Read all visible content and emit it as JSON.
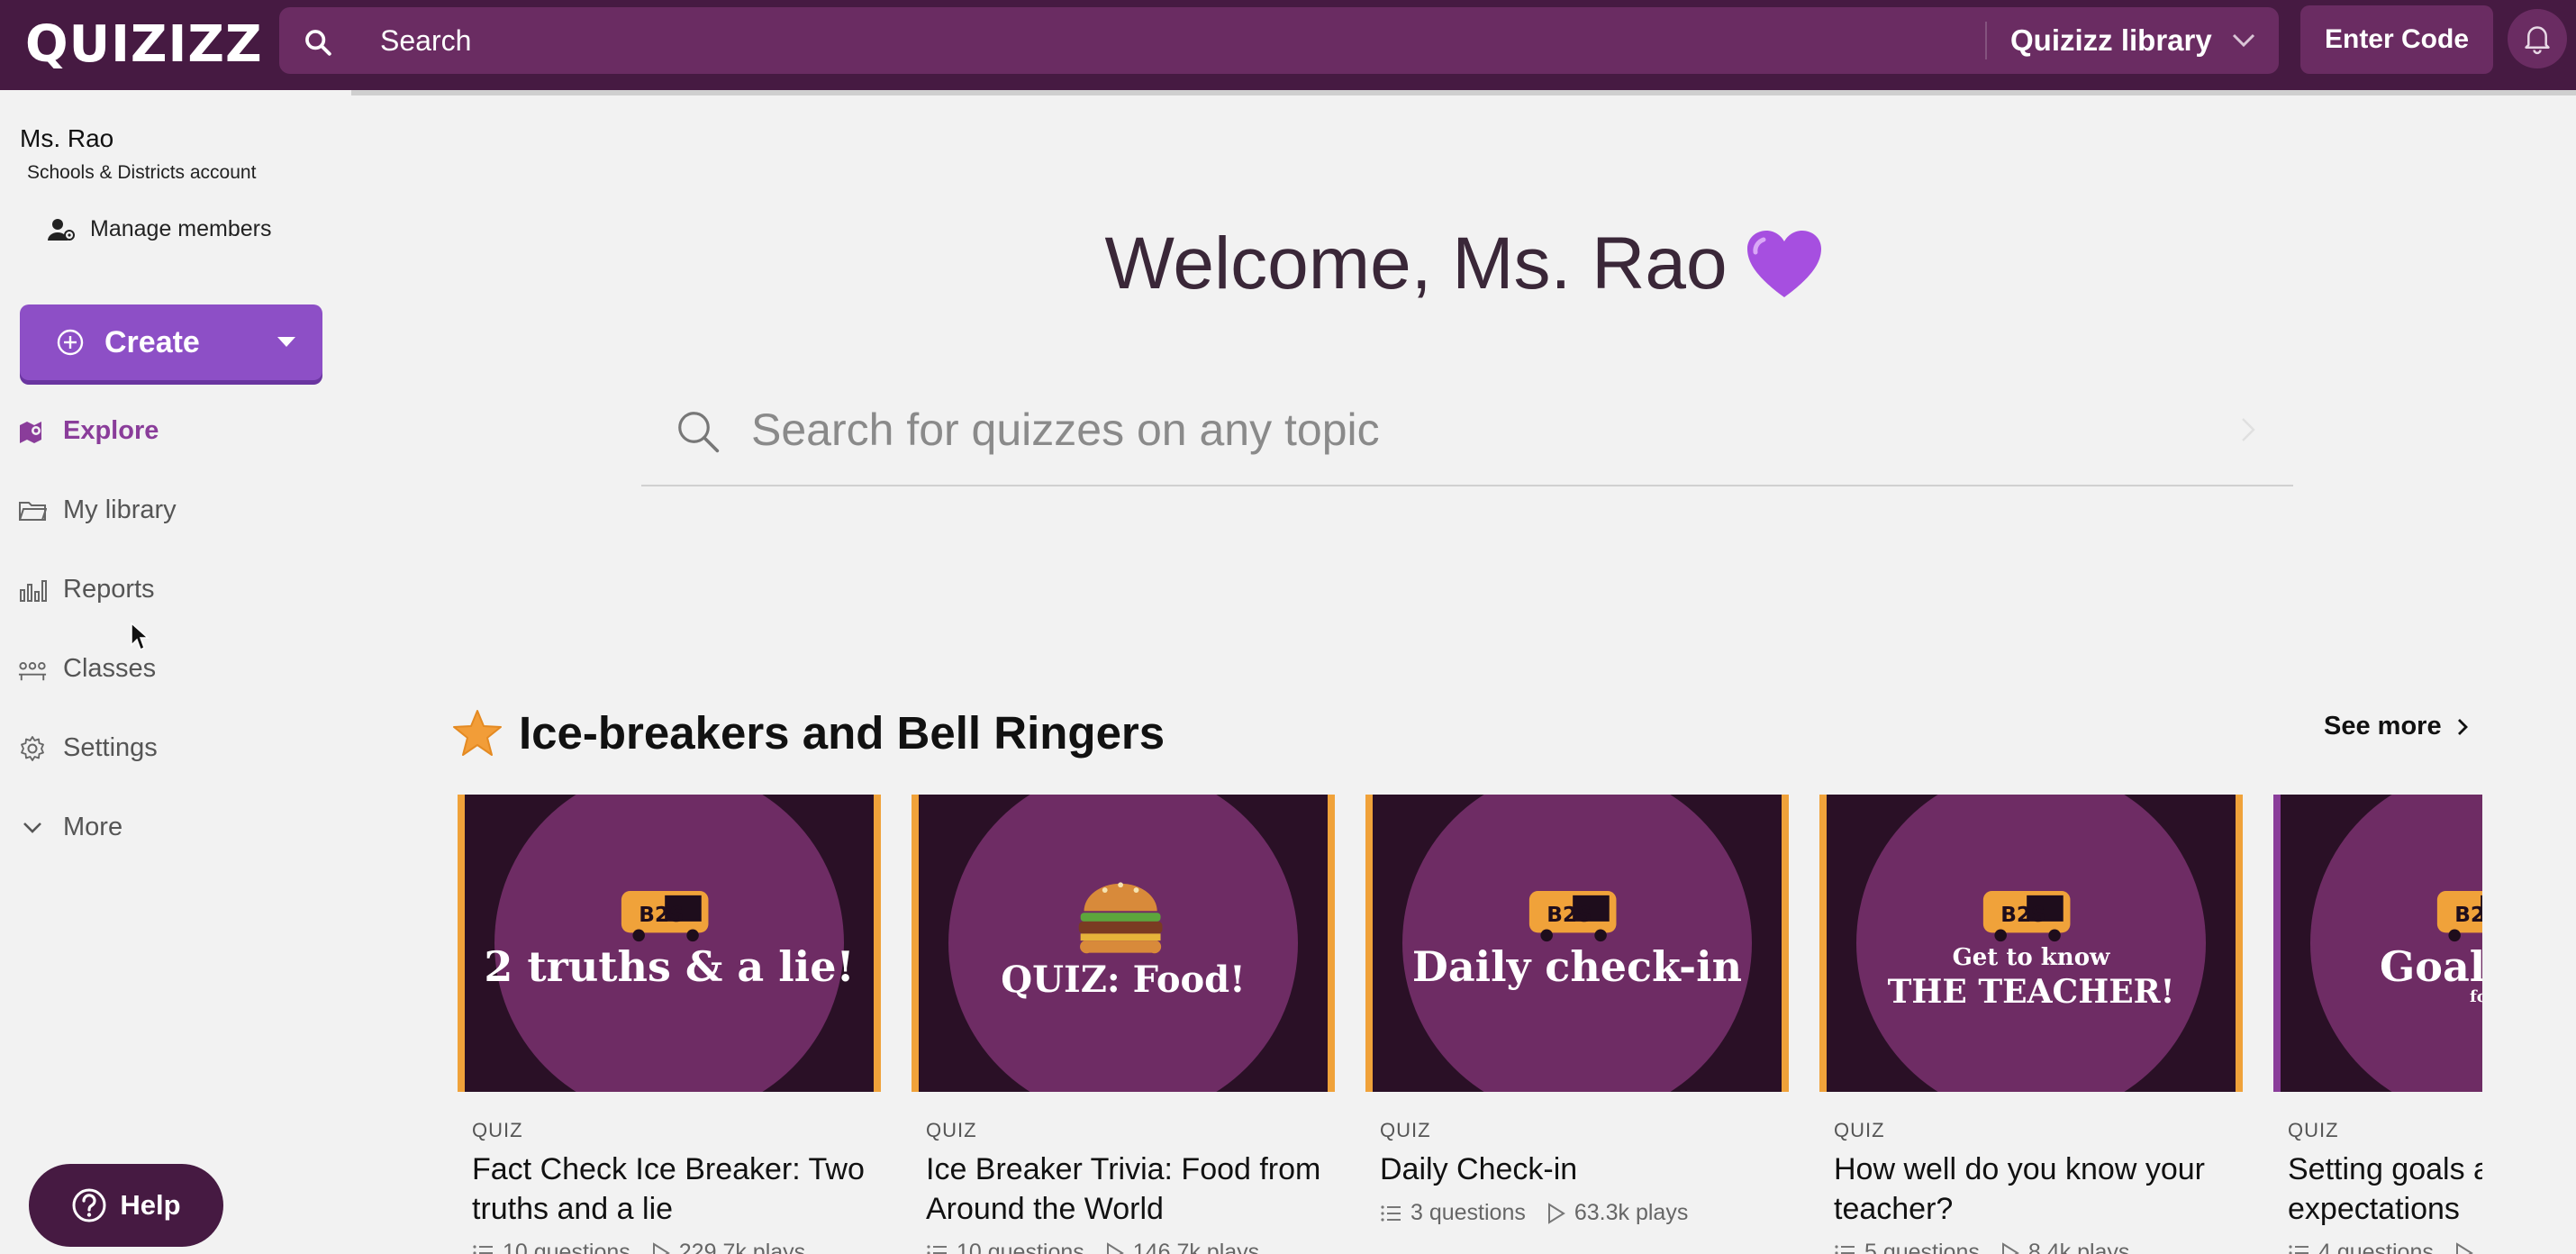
{
  "header": {
    "logo": "QUIZIZZ",
    "search_placeholder": "Search",
    "library_select": "Quizizz library",
    "enter_code": "Enter Code"
  },
  "sidebar": {
    "user_name": "Ms. Rao",
    "account_type": "Schools & Districts account",
    "manage_members": "Manage members",
    "create": "Create",
    "nav": [
      {
        "label": "Explore",
        "icon": "explore-icon"
      },
      {
        "label": "My library",
        "icon": "folder-icon"
      },
      {
        "label": "Reports",
        "icon": "reports-icon"
      },
      {
        "label": "Classes",
        "icon": "classes-icon"
      },
      {
        "label": "Settings",
        "icon": "settings-icon"
      },
      {
        "label": "More",
        "icon": "chevron-down-icon"
      }
    ],
    "help": "Help"
  },
  "main": {
    "welcome": "Welcome, Ms. Rao",
    "welcome_emoji": "purple-heart-icon",
    "quiz_search_placeholder": "Search for quizzes on any topic",
    "section": {
      "title": "Ice-breakers and Bell Ringers",
      "see_more": "See more",
      "cards": [
        {
          "type": "QUIZ",
          "title": "Fact Check Ice Breaker: Two truths and a lie",
          "questions": "10 questions",
          "plays": "229.7k plays",
          "thumb_lines": [
            "2 truths & a lie!"
          ]
        },
        {
          "type": "QUIZ",
          "title": "Ice Breaker Trivia: Food from Around the World",
          "questions": "10 questions",
          "plays": "146.7k plays",
          "thumb_lines": [
            "QUIZ: Food!"
          ]
        },
        {
          "type": "QUIZ",
          "title": "Daily Check-in",
          "questions": "3 questions",
          "plays": "63.3k plays",
          "thumb_lines": [
            "Daily check-in"
          ]
        },
        {
          "type": "QUIZ",
          "title": "How well do you know your teacher?",
          "questions": "5 questions",
          "plays": "8.4k plays",
          "thumb_lines": [
            "Get to know",
            "THE TEACHER!"
          ]
        },
        {
          "type": "QUIZ",
          "title": "Setting goals and expectations",
          "questions": "4 questions",
          "plays": "",
          "thumb_lines": [
            "Goal S",
            "for th"
          ]
        }
      ]
    }
  },
  "colors": {
    "topbar": "#461a42",
    "accent": "#8d4fc6",
    "active_nav": "#8a3d9a",
    "card_disc": "#6e2c64",
    "card_border": "#f0a23a"
  }
}
